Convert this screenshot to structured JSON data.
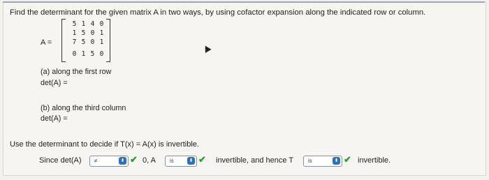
{
  "question": {
    "prompt": "Find the determinant for the given matrix A in two ways, by using cofactor expansion along the indicated row or column.",
    "matrix_label": "A =",
    "matrix_rows": [
      [
        "5",
        "1",
        "4",
        "0"
      ],
      [
        "1",
        "5",
        "0",
        "1"
      ],
      [
        "7",
        "5",
        "0",
        "1"
      ],
      [
        "0",
        "1",
        "5",
        "0"
      ]
    ]
  },
  "part_a": {
    "label": "(a) along the first row",
    "det_label": "det(A) ="
  },
  "part_b": {
    "label": "(b) along the third column",
    "det_label": "det(A) ="
  },
  "invertible": {
    "prompt": "Use the determinant to decide if T(x) = A(x) is invertible.",
    "since_label": "Since det(A)",
    "dropdown1_value": "≠",
    "zero_text": "0, A",
    "dropdown2_value": "is",
    "middle_text": "invertible, and hence T",
    "dropdown3_value": "is",
    "end_text": "invertible."
  },
  "icons": {
    "check": "✔",
    "dropdown_knob": "⬍"
  },
  "colors": {
    "accent": "#2d6fb8",
    "check": "#2a9d3a"
  }
}
